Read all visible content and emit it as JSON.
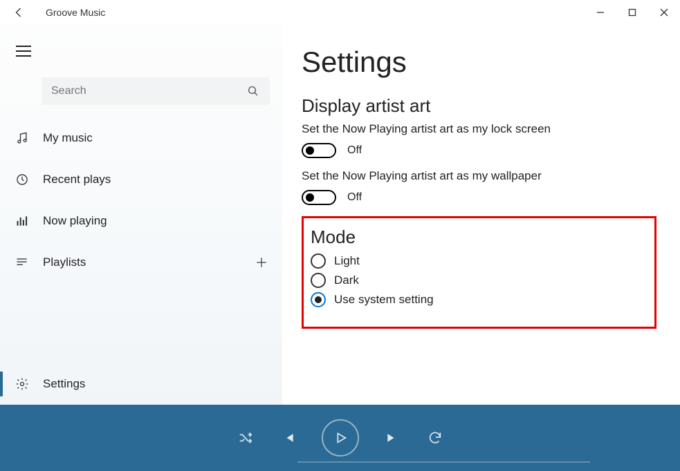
{
  "app": {
    "title": "Groove Music"
  },
  "search": {
    "placeholder": "Search"
  },
  "sidebar": {
    "items": [
      {
        "label": "My music"
      },
      {
        "label": "Recent plays"
      },
      {
        "label": "Now playing"
      },
      {
        "label": "Playlists"
      },
      {
        "label": "Settings"
      }
    ]
  },
  "settings": {
    "page_title": "Settings",
    "artist_art": {
      "section_title": "Display artist art",
      "lock_label": "Set the Now Playing artist art as my lock screen",
      "lock_state": "Off",
      "wall_label": "Set the Now Playing artist art as my wallpaper",
      "wall_state": "Off"
    },
    "mode": {
      "section_title": "Mode",
      "options": [
        {
          "label": "Light"
        },
        {
          "label": "Dark"
        },
        {
          "label": "Use system setting"
        }
      ],
      "selected_index": 2
    }
  },
  "colors": {
    "accent": "#2b6a95",
    "highlight_box": "#e60000",
    "radio_selected": "#0078d7"
  }
}
